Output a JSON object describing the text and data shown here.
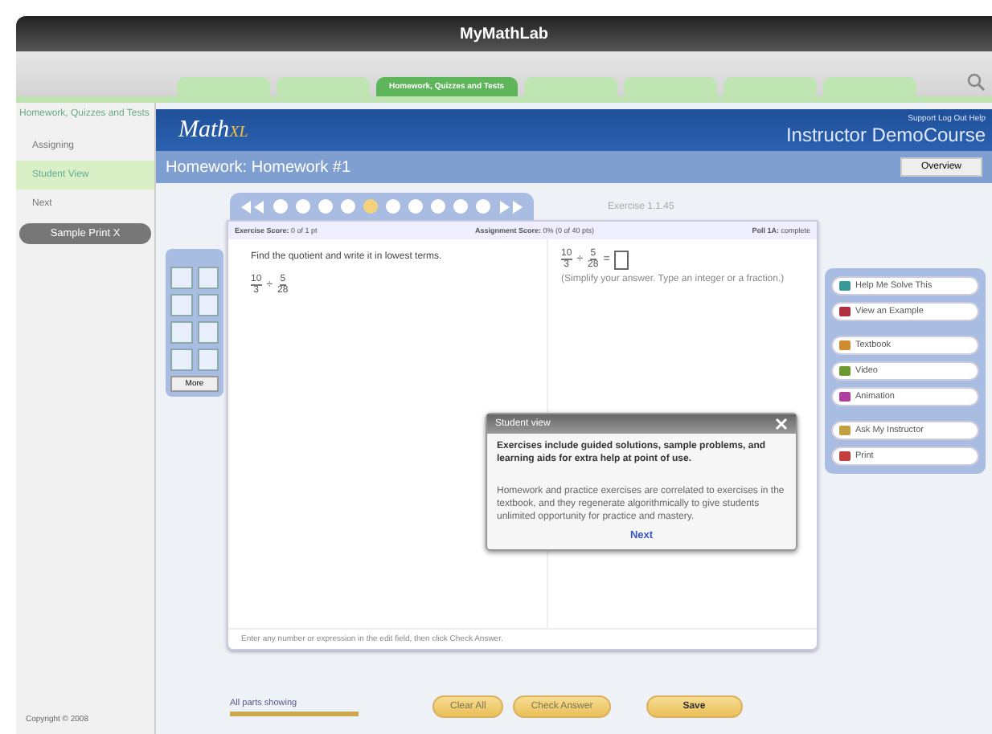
{
  "window": {
    "title": "MyMathLab"
  },
  "tabs": [
    {
      "selected": false
    },
    {
      "selected": false
    },
    {
      "label": "Homework, Quizzes and Tests",
      "selected": true
    },
    {
      "selected": false
    },
    {
      "selected": false
    },
    {
      "selected": false
    },
    {
      "selected": false
    }
  ],
  "sidebar": {
    "heading": "Homework, Quizzes and Tests",
    "items": [
      {
        "label": "Assigning",
        "selected": false
      },
      {
        "label": "Student View",
        "selected": true
      },
      {
        "label": "Next",
        "selected": false
      }
    ],
    "button": "Sample Print X",
    "copyright": "Copyright © 2008"
  },
  "header": {
    "logo": "Math",
    "logo_suffix": "XL",
    "links": "Support  Log Out  Help",
    "course": "Instructor DemoCourse"
  },
  "homework": {
    "title": "Homework:  Homework #1",
    "overview": "Overview"
  },
  "nav": {
    "questions": [
      {
        "selected": false
      },
      {
        "selected": false
      },
      {
        "selected": false
      },
      {
        "selected": false
      },
      {
        "selected": true
      },
      {
        "selected": false
      },
      {
        "selected": false
      },
      {
        "selected": false
      },
      {
        "selected": false
      },
      {
        "selected": false
      }
    ],
    "exercise": "Exercise 1.1.45"
  },
  "scores": {
    "exercise_label": "Exercise Score:",
    "exercise": "0 of 1 pt",
    "assignment_label": "Assignment Score:",
    "assignment": "0% (0 of 40 pts)",
    "poll_label": "Poll 1A:",
    "poll": "complete"
  },
  "question": {
    "prompt": "Find the quotient and write it in lowest terms.",
    "problem": {
      "a_num": "10",
      "a_den": "3",
      "op": "÷",
      "b_num": "5",
      "b_den": "28"
    },
    "answer": {
      "a_num": "10",
      "a_den": "3",
      "op": "÷",
      "b_num": "5",
      "b_den": "28",
      "equals": "="
    },
    "hint": "(Simplify your answer. Type an integer or a fraction.)"
  },
  "palette": {
    "more": "More"
  },
  "tools": [
    {
      "label": "Help Me Solve This",
      "kind": "help"
    },
    {
      "label": "View an Example",
      "kind": "example"
    },
    {
      "label": "Textbook",
      "kind": "book"
    },
    {
      "label": "Video",
      "kind": "video"
    },
    {
      "label": "Animation",
      "kind": "animation"
    },
    {
      "label": "Ask My Instructor",
      "kind": "ask"
    },
    {
      "label": "Print",
      "kind": "print"
    }
  ],
  "popup": {
    "title": "Student view",
    "paragraphs": [
      "Exercises include guided solutions, sample problems, and learning aids for extra help at point of use.",
      "Homework and practice exercises are correlated to exercises in the textbook, and they regenerate algorithmically to give students unlimited opportunity for practice and mastery."
    ],
    "next": "Next"
  },
  "footer": {
    "instruction": "Enter any number or expression in the edit field, then click Check Answer.",
    "parts": "All parts showing",
    "buttons": [
      "Clear All",
      "Check Answer",
      "Save"
    ]
  }
}
